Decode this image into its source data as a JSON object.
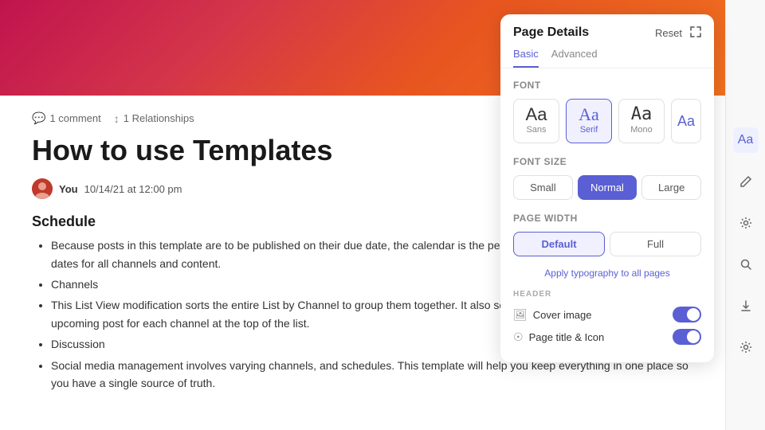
{
  "header_banner": {},
  "meta": {
    "comment_count": "1 comment",
    "relationship_count": "1 Relationships"
  },
  "page": {
    "title": "How to use Templates",
    "author": "You",
    "date": "10/14/21 at 12:00 pm"
  },
  "content": {
    "section_title": "Schedule",
    "bullets": [
      "Because posts in this template are to be published on their due date, the calendar is the perfect place to manage publication dates for all channels and content.",
      "Channels",
      "This List View modification sorts the entire List by Channel to group them together. It also sorts by due date so you can see the upcoming post for each channel at the top of the list.",
      "Discussion",
      "Social media management involves varying channels, and schedules. This template will help you keep everything in one place so you have a single source of truth."
    ]
  },
  "sidebar_icons": [
    "Aa",
    "✏",
    "⚙",
    "🔍",
    "⬇",
    "⚙"
  ],
  "panel": {
    "title": "Page Details",
    "reset_label": "Reset",
    "expand_icon": "⤢",
    "tabs": [
      {
        "label": "Basic",
        "active": true
      },
      {
        "label": "Advanced",
        "active": false
      }
    ],
    "font_section": {
      "label": "Font",
      "options": [
        {
          "preview": "Aa",
          "name": "Sans",
          "selected": false
        },
        {
          "preview": "Aa",
          "name": "Serif",
          "selected": true
        },
        {
          "preview": "Aa",
          "name": "Mono",
          "selected": false
        }
      ],
      "extra_label": "Aa"
    },
    "font_size_section": {
      "label": "Font Size",
      "options": [
        {
          "label": "Small",
          "selected": false
        },
        {
          "label": "Normal",
          "selected": true
        },
        {
          "label": "Large",
          "selected": false
        }
      ]
    },
    "page_width_section": {
      "label": "Page Width",
      "options": [
        {
          "label": "Default",
          "selected": true
        },
        {
          "label": "Full",
          "selected": false
        }
      ]
    },
    "apply_link": "Apply typography to all pages",
    "header_section": {
      "label": "HEADER",
      "toggles": [
        {
          "label": "Cover image",
          "enabled": true
        },
        {
          "label": "Page title & Icon",
          "enabled": true
        }
      ]
    }
  }
}
